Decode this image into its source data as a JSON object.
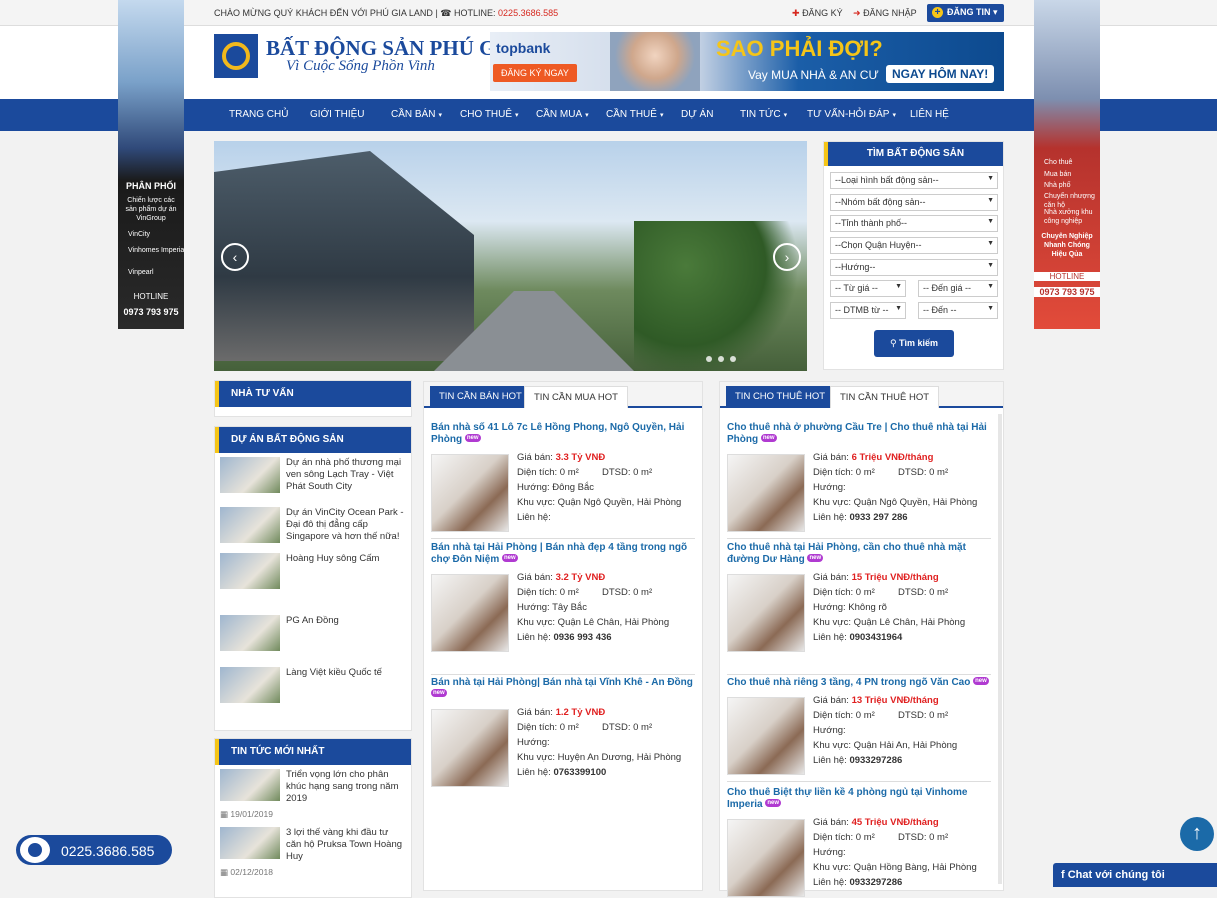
{
  "topbar": {
    "welcome": "CHÀO MỪNG QUÝ KHÁCH ĐẾN VỚI PHÚ GIA LAND",
    "hotline_label": "HOTLINE:",
    "hotline_number": "0225.3686.585",
    "register": "ĐĂNG KÝ",
    "login": "ĐĂNG NHẬP",
    "post": "ĐĂNG TIN"
  },
  "logo": {
    "name": "BẤT ĐỘNG SẢN PHÚ GIA",
    "slogan": "Vì Cuộc Sống Phồn Vinh"
  },
  "banner": {
    "brand": "topbank",
    "cta": "ĐĂNG KÝ NGAY",
    "headline": "SAO PHẢI ĐỢI?",
    "sub": "Vay MUA NHÀ & AN CƯ",
    "now": "NGAY HÔM NAY!"
  },
  "nav": [
    {
      "label": "TRANG CHỦ",
      "caret": false
    },
    {
      "label": "GIỚI THIỆU",
      "caret": false
    },
    {
      "label": "CẦN BÁN",
      "caret": true
    },
    {
      "label": "CHO THUÊ",
      "caret": true
    },
    {
      "label": "CẦN MUA",
      "caret": true
    },
    {
      "label": "CẦN THUÊ",
      "caret": true
    },
    {
      "label": "DỰ ÁN",
      "caret": false
    },
    {
      "label": "TIN TỨC",
      "caret": true
    },
    {
      "label": "TƯ VẤN-HỎI ĐÁP",
      "caret": true
    },
    {
      "label": "LIÊN HỆ",
      "caret": false
    }
  ],
  "left_ad": {
    "heading": "PHÂN PHỐI",
    "desc": "Chiến lược các sản phẩm dự án VinGroup",
    "items": [
      "VinCity",
      "Vinhomes Imperia",
      "Vinpearl"
    ],
    "hotline_label": "HOTLINE",
    "phone": "0973 793 975"
  },
  "right_ad": {
    "items": [
      "Cho thuê",
      "Mua bán",
      "Nhà phố",
      "Chuyển nhượng căn hộ",
      "Nhà xưởng khu công nghiệp"
    ],
    "tagline": "Chuyên Nghiệp Nhanh Chóng Hiệu Qủa",
    "hotline_label": "HOTLINE",
    "phone": "0973 793 975"
  },
  "search": {
    "title": "TÌM BẤT ĐỘNG SẢN",
    "selects": [
      "--Loại hình bất động sản--",
      "--Nhóm bất động sản--",
      "--Tỉnh thành phố--",
      "--Chọn Quận Huyện--",
      "--Hướng--"
    ],
    "price_from": "-- Từ giá --",
    "price_to": "-- Đến giá --",
    "area_from": "-- DTMB từ --",
    "area_to": "-- Đến --",
    "button": "Tìm kiếm"
  },
  "advisors": {
    "title": "NHÀ TƯ VẤN"
  },
  "projects": {
    "title": "DỰ ÁN BẤT ĐỘNG SẢN",
    "items": [
      "Dự án nhà phố thương mại ven sông Lạch Tray - Việt Phát South City",
      "Dự án VinCity Ocean Park - Đại đô thị đẳng cấp Singapore và hơn thế nữa!",
      "Hoàng Huy sông Cấm",
      "PG An Đồng",
      "Làng Việt kiều Quốc tế"
    ]
  },
  "news": {
    "title": "TIN TỨC MỚI NHẤT",
    "items": [
      {
        "title": "Triển vọng lớn cho phân khúc hạng sang trong năm 2019",
        "date": "19/01/2019"
      },
      {
        "title": "3 lợi thế vàng khi đầu tư căn hộ Pruksa Town Hoàng Huy",
        "date": "02/12/2018"
      }
    ]
  },
  "sale": {
    "tab_active": "TIN CẦN BÁN HOT",
    "tab_other": "TIN CẦN MUA HOT",
    "items": [
      {
        "title": "Bán nhà số 41 Lô 7c Lê Hồng Phong, Ngô Quyền, Hải Phòng",
        "price_label": "Giá bán:",
        "price": "3.3 Tỷ VNĐ",
        "area": "Diện tích: 0 m²",
        "dtsd": "DTSD: 0 m²",
        "direction": "Hướng: Đông Bắc",
        "region": "Khu vực: Quận Ngô Quyền, Hải Phòng",
        "contact_label": "Liên hệ:",
        "contact": ""
      },
      {
        "title": "Bán nhà tại Hải Phòng | Bán nhà đẹp 4 tầng trong ngõ chợ Đôn Niệm",
        "price_label": "Giá bán:",
        "price": "3.2 Tỷ VNĐ",
        "area": "Diện tích: 0 m²",
        "dtsd": "DTSD: 0 m²",
        "direction": "Hướng: Tây Bắc",
        "region": "Khu vực: Quận Lê Chân, Hải Phòng",
        "contact_label": "Liên hệ:",
        "contact": "0936 993 436"
      },
      {
        "title": "Bán nhà tại Hải Phòng| Bán nhà tại Vĩnh Khê - An Đồng",
        "price_label": "Giá bán:",
        "price": "1.2 Tỷ VNĐ",
        "area": "Diện tích: 0 m²",
        "dtsd": "DTSD: 0 m²",
        "direction": "Hướng:",
        "region": "Khu vực: Huyện An Dương, Hải Phòng",
        "contact_label": "Liên hệ:",
        "contact": "0763399100"
      }
    ]
  },
  "rent": {
    "tab_active": "TIN CHO THUÊ HOT",
    "tab_other": "TIN CẦN THUÊ HOT",
    "items": [
      {
        "title": "Cho thuê nhà ở phường Cầu Tre | Cho thuê nhà tại Hải Phòng",
        "price_label": "Giá bán:",
        "price": "6 Triệu VNĐ/tháng",
        "area": "Diện tích: 0 m²",
        "dtsd": "DTSD: 0 m²",
        "direction": "Hướng:",
        "region": "Khu vực: Quận Ngô Quyền, Hải Phòng",
        "contact_label": "Liên hệ:",
        "contact": "0933 297 286"
      },
      {
        "title": "Cho thuê nhà tại Hải Phòng, cần cho thuê nhà mặt đường Dư Hàng",
        "price_label": "Giá bán:",
        "price": "15 Triệu VNĐ/tháng",
        "area": "Diện tích: 0 m²",
        "dtsd": "DTSD: 0 m²",
        "direction": "Hướng: Không rõ",
        "region": "Khu vực: Quận Lê Chân, Hải Phòng",
        "contact_label": "Liên hệ:",
        "contact": "0903431964"
      },
      {
        "title": "Cho thuê nhà riêng 3 tầng, 4 PN trong ngõ Văn Cao",
        "price_label": "Giá bán:",
        "price": "13 Triệu VNĐ/tháng",
        "area": "Diện tích: 0 m²",
        "dtsd": "DTSD: 0 m²",
        "direction": "Hướng:",
        "region": "Khu vực: Quận Hải An, Hải Phòng",
        "contact_label": "Liên hệ:",
        "contact": "0933297286"
      },
      {
        "title": "Cho thuê Biệt thự liền kề 4 phòng ngủ tại Vinhome Imperia",
        "price_label": "Giá bán:",
        "price": "45 Triệu VNĐ/tháng",
        "area": "Diện tích: 0 m²",
        "dtsd": "DTSD: 0 m²",
        "direction": "Hướng:",
        "region": "Khu vực: Quận Hồng Bàng, Hải Phòng",
        "contact_label": "Liên hệ:",
        "contact": "0933297286"
      }
    ]
  },
  "float": {
    "hotline": "0225.3686.585",
    "chat": "Chat với chúng tôi"
  }
}
